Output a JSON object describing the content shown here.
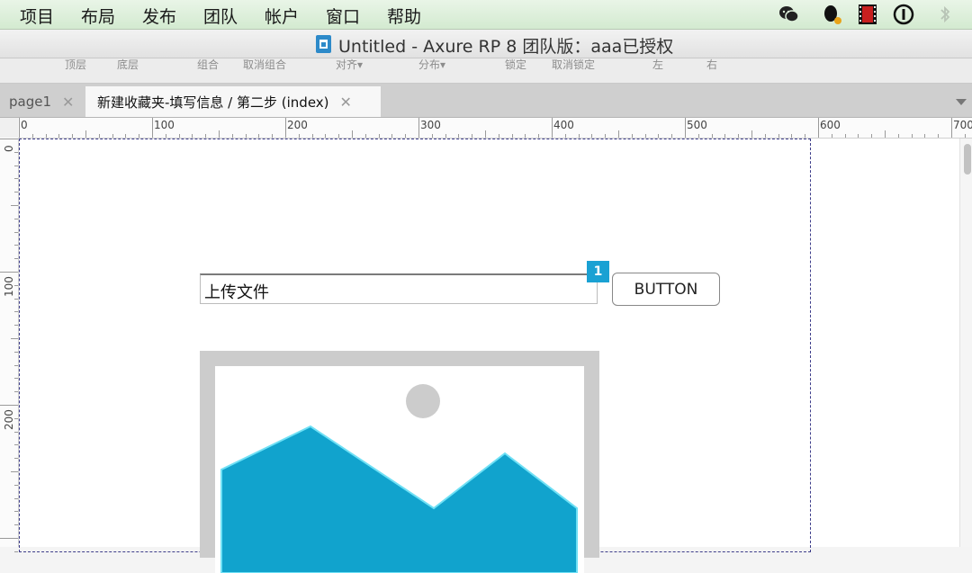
{
  "menubar": {
    "items": [
      "项目",
      "布局",
      "发布",
      "团队",
      "帐户",
      "窗口",
      "帮助"
    ],
    "tray_icons": [
      "wechat-icon",
      "qq-icon",
      "video-icon",
      "1password-icon",
      "bluetooth-icon"
    ]
  },
  "window": {
    "title": "Untitled - Axure RP 8 团队版：aaa已授权"
  },
  "toolbar": {
    "labels": [
      "顶层",
      "底层",
      "组合",
      "取消组合",
      "对齐▾",
      "分布▾",
      "锁定",
      "取消锁定",
      "左",
      "右"
    ]
  },
  "tabs": [
    {
      "label": "page1",
      "active": false,
      "close": "✕"
    },
    {
      "label": "新建收藏夹-填写信息 / 第二步 (index)",
      "active": true,
      "close": "✕"
    }
  ],
  "ruler": {
    "top_labels": [
      "0",
      "100",
      "200",
      "300",
      "400",
      "500",
      "600",
      "700"
    ],
    "left_labels": [
      "0",
      "100",
      "200"
    ]
  },
  "canvas": {
    "upload_field_value": "上传文件",
    "footnote_number": "1",
    "button_label": "BUTTON",
    "image_placeholder": {
      "mountain_color": "#11a3cd",
      "sun_color": "#cccccc",
      "frame_color": "#cccccc"
    }
  },
  "colors": {
    "menubar_bg": "#dcefd9",
    "accent": "#1aa1d3"
  }
}
